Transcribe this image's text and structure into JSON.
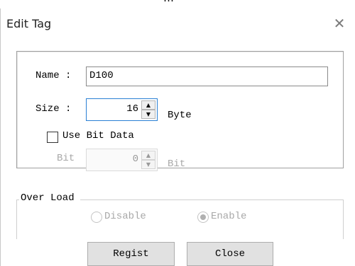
{
  "top_fragment": "…",
  "dialog": {
    "title": "Edit Tag",
    "close_glyph": "✕"
  },
  "tag": {
    "name_label": "Name :",
    "name_value": "D100",
    "size_label": "Size :",
    "size_value": "16",
    "size_unit": "Byte",
    "use_bit_label": "Use Bit Data",
    "use_bit_checked": false,
    "bit_label": "Bit",
    "bit_value": "0",
    "bit_unit": "Bit"
  },
  "overload": {
    "legend": "Over Load",
    "options": [
      {
        "label": "Disable",
        "selected": false
      },
      {
        "label": "Enable",
        "selected": true
      }
    ]
  },
  "buttons": {
    "regist": "Regist",
    "close": "Close"
  },
  "spin_glyphs": {
    "up": "▲",
    "down": "▼"
  }
}
